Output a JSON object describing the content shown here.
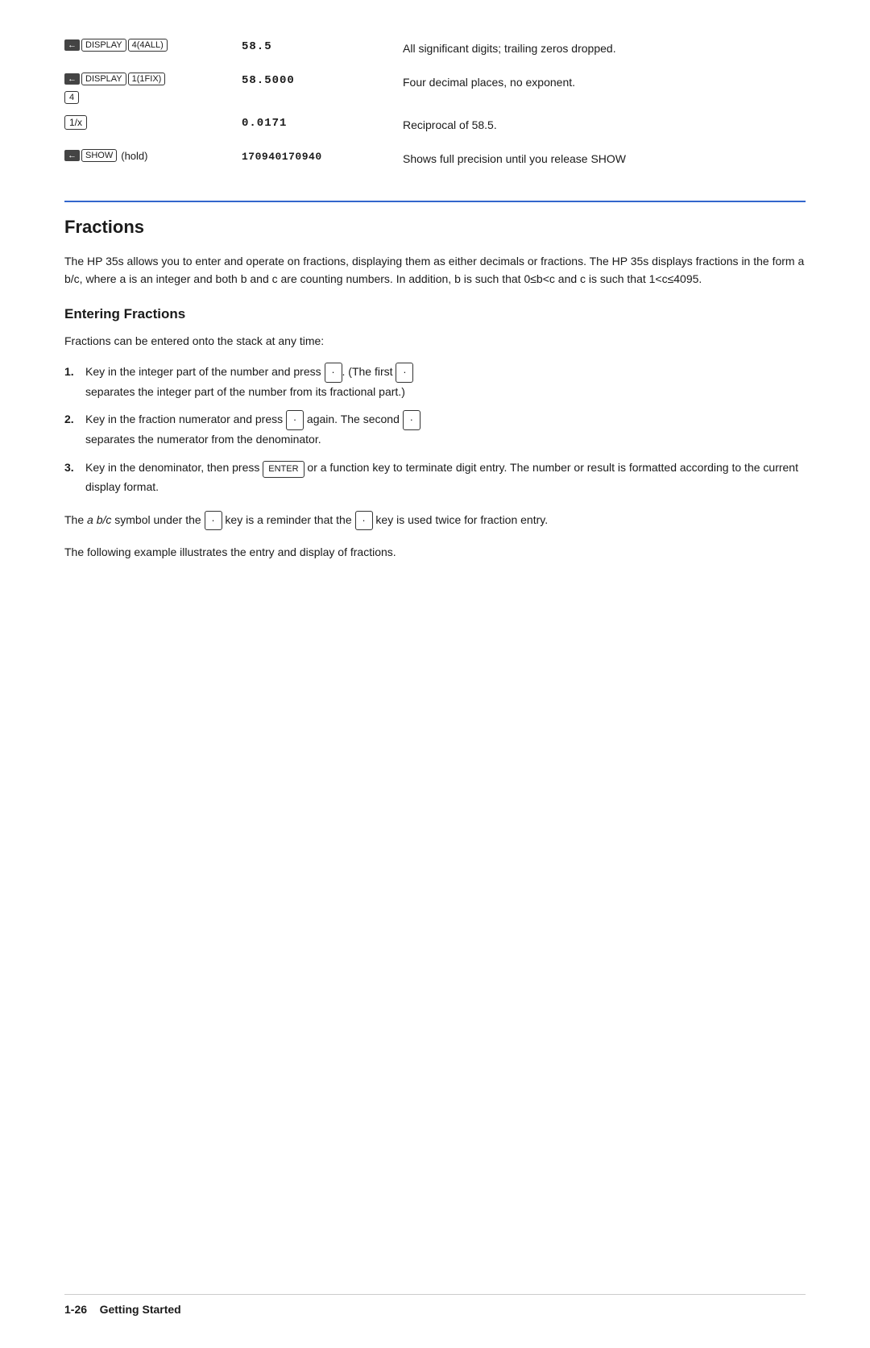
{
  "table": {
    "rows": [
      {
        "id": "row1",
        "keys_html": "shift_display_4all",
        "display": "58.5",
        "desc": "All significant digits; trailing zeros dropped."
      },
      {
        "id": "row2",
        "keys_html": "shift_display_1fix_4",
        "display": "58.5000",
        "desc": "Four decimal places, no exponent."
      },
      {
        "id": "row3",
        "keys_html": "recip",
        "display": "0.0171",
        "desc": "Reciprocal of 58.5."
      },
      {
        "id": "row4",
        "keys_html": "shift_show_hold",
        "display": "170940170940",
        "desc": "Shows full precision until you release SHOW"
      }
    ]
  },
  "fractions_section": {
    "heading": "Fractions",
    "intro": "The HP 35s allows you to enter and operate on fractions, displaying them as either decimals or fractions. The HP 35s displays fractions in the form a b/c, where a is an integer and both b and c are counting numbers. In addition, b is such that 0≤b<c and c is such that 1<c≤4095."
  },
  "entering_fractions": {
    "heading": "Entering Fractions",
    "intro": "Fractions can be entered onto the stack at any time:",
    "steps": [
      {
        "num": "1.",
        "text_before": "Key in the integer part of the number and press",
        "key": "·",
        "text_after": ". (The first",
        "key2": "·",
        "continuation": "separates the integer part of the number from its fractional part.)"
      },
      {
        "num": "2.",
        "text_before": "Key in the fraction numerator and press",
        "key": "·",
        "text_after": "again. The second",
        "key2": "·",
        "continuation": "separates the numerator from the denominator."
      },
      {
        "num": "3.",
        "text_before": "Key in the denominator, then press",
        "key": "ENTER",
        "text_after": "or a function key to terminate digit entry. The number or result is formatted according to the current display format."
      }
    ],
    "note": "The a b/c symbol under the · key is a reminder that the · key is used twice for fraction entry.",
    "example_note": "The following example illustrates the entry and display of fractions."
  },
  "footer": {
    "page": "1-26",
    "section": "Getting Started"
  },
  "labels": {
    "shift": "←",
    "display": "DISPLAY",
    "show": "SHOW",
    "four_all": "4(4ALL)",
    "one_fix": "1(1FIX)",
    "four": "4",
    "recip": "1/x",
    "hold": "(hold)",
    "enter": "ENTER",
    "dot": "·"
  }
}
